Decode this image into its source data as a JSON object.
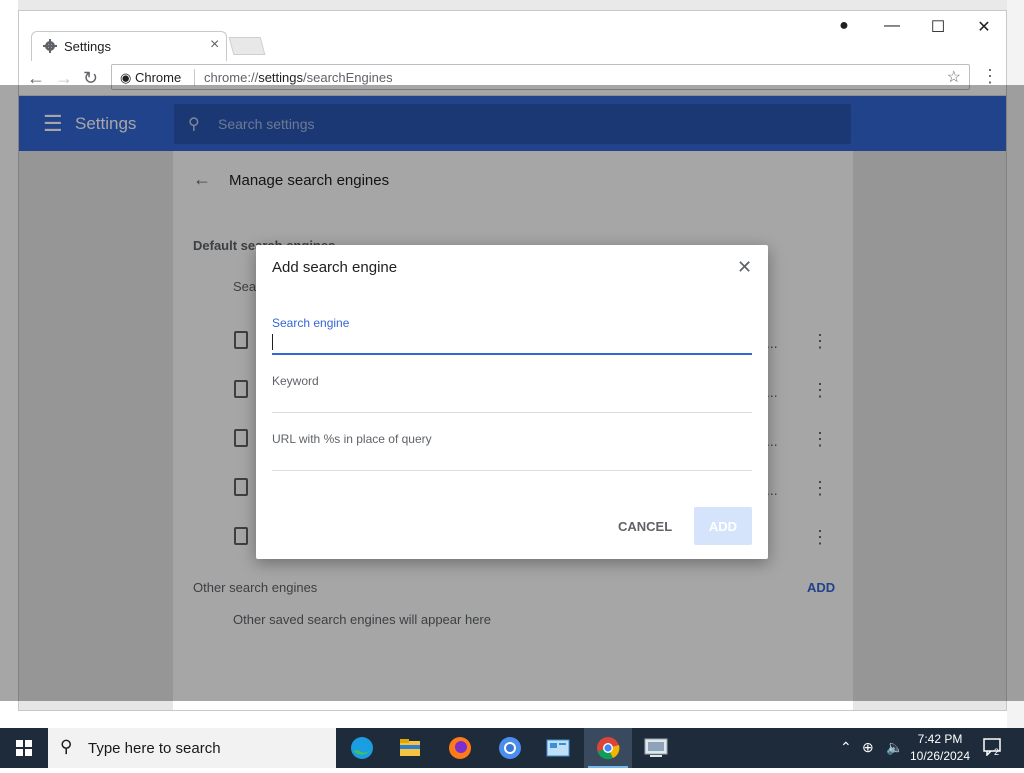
{
  "browser": {
    "tab_title": "Settings",
    "omnibox_chip": "Chrome",
    "url_scheme": "chrome://",
    "url_host": "settings",
    "url_path": "/searchEngines"
  },
  "settings": {
    "app_title": "Settings",
    "search_placeholder": "Search settings",
    "page_heading": "Manage search engines",
    "default_section_label": "Default search engines",
    "column_label": "Search engine",
    "other_section_label": "Other search engines",
    "other_add_label": "ADD",
    "other_empty_text": "Other saved search engines will appear here"
  },
  "dialog": {
    "title": "Add search engine",
    "fields": [
      {
        "label": "Search engine",
        "value": ""
      },
      {
        "label": "Keyword",
        "value": ""
      },
      {
        "label": "URL with %s in place of query",
        "value": ""
      }
    ],
    "cancel_label": "CANCEL",
    "add_label": "ADD"
  },
  "taskbar": {
    "search_placeholder": "Type here to search",
    "apps": [
      "Microsoft Edge",
      "File Explorer",
      "Firefox",
      "Chromium",
      "Control Panel",
      "Google Chrome",
      "Remote Desktop"
    ],
    "time": "7:42 PM",
    "date": "10/26/2024",
    "notification_count": "2"
  },
  "colors": {
    "accent": "#3367d6",
    "taskbar": "#1d2b3b"
  },
  "icons": [
    "settings-gear-icon",
    "back-arrow-icon",
    "forward-arrow-icon",
    "reload-icon",
    "star-icon",
    "menu-dots-icon",
    "hamburger-icon",
    "search-icon",
    "close-icon",
    "document-icon",
    "more-vert-icon",
    "windows-start-icon",
    "edge-icon",
    "folder-icon",
    "firefox-icon",
    "chromium-icon",
    "chrome-icon",
    "network-icon",
    "volume-muted-icon",
    "notification-icon"
  ]
}
